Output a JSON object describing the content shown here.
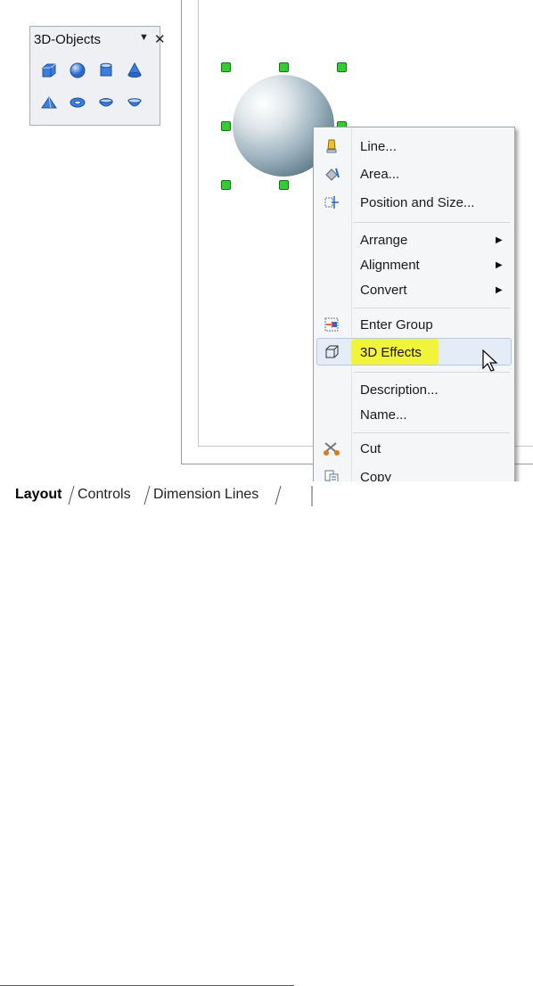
{
  "toolbar": {
    "title": "3D-Objects",
    "menu_glyph": "▼",
    "close_glyph": "✕",
    "buttons": [
      "cube",
      "sphere",
      "cylinder",
      "cone",
      "pyramid",
      "torus",
      "shell",
      "half-sphere"
    ]
  },
  "context_menu": {
    "items": [
      {
        "label": "Line...",
        "icon": "line-icon"
      },
      {
        "label": "Area...",
        "icon": "area-icon"
      },
      {
        "label": "Position and Size...",
        "icon": "position-size-icon"
      },
      {
        "label": "Arrange",
        "submenu": true
      },
      {
        "label": "Alignment",
        "submenu": true
      },
      {
        "label": "Convert",
        "submenu": true
      },
      {
        "label": "Enter Group",
        "icon": "enter-group-icon"
      },
      {
        "label": "3D Effects",
        "icon": "3d-effects-icon",
        "highlighted": true
      },
      {
        "label": "Description..."
      },
      {
        "label": "Name..."
      },
      {
        "label": "Cut",
        "icon": "cut-icon"
      },
      {
        "label": "Copy",
        "icon": "copy-icon"
      }
    ],
    "submenu_arrow": "▶"
  },
  "tabs": {
    "layout": "Layout",
    "controls": "Controls",
    "dimension_lines": "Dimension Lines"
  },
  "colors": {
    "highlight_marker": "#f5f51a",
    "selection_handle": "#33cc33",
    "menu_highlight": "#e3ecf7"
  }
}
